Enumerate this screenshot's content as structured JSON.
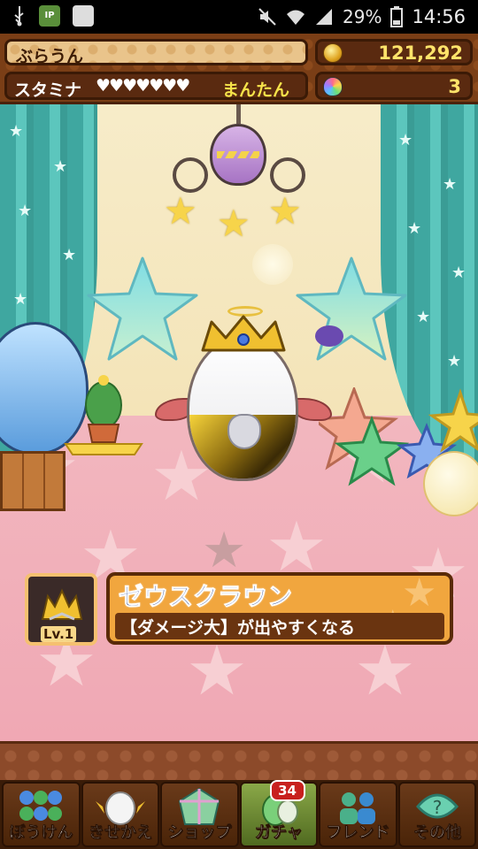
{
  "status_bar": {
    "icons": [
      "usb-icon",
      "ip-icon",
      "app-icon"
    ],
    "ip_label": "IP",
    "right_icons": [
      "mute-icon",
      "wifi-icon",
      "signal-icon",
      "battery-icon"
    ],
    "battery": "29%",
    "time": "14:56"
  },
  "player": {
    "name": "ぶらうん",
    "stamina_label": "スタミナ",
    "stamina_hearts": "♥♥♥♥♥♥♥",
    "stamina_status": "まんたん",
    "coins": "121,292",
    "gems": "3"
  },
  "monster_card": {
    "name": "ゼウスクラウン",
    "skill": "【ダメージ大】が出やすくなる",
    "level": "Lv.1"
  },
  "nav": {
    "items": [
      {
        "label": "ぼうけん",
        "icon": "adventure-icon"
      },
      {
        "label": "きせかえ",
        "icon": "dressup-icon"
      },
      {
        "label": "ショップ",
        "icon": "shop-icon"
      },
      {
        "label": "ガチャ",
        "icon": "gacha-icon",
        "badge": "34"
      },
      {
        "label": "フレンド",
        "icon": "friend-icon"
      },
      {
        "label": "その他",
        "icon": "other-icon"
      }
    ]
  },
  "colors": {
    "header_brown": "#7a3e16",
    "card_orange": "#f1a63e",
    "card_name_blue": "#2c4a98",
    "coin_yellow": "#ffe36a",
    "floor_pink": "#f2b7bf",
    "curtain_teal": "#3fa7a0"
  }
}
